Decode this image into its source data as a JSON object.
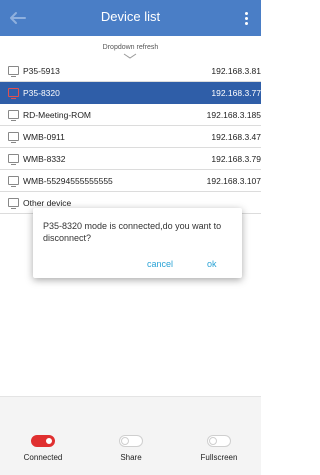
{
  "header": {
    "title": "Device list"
  },
  "refresh_hint": "Dropdown refresh",
  "devices": [
    {
      "name": "P35-5913",
      "ip": "192.168.3.81",
      "selected": false
    },
    {
      "name": "P35-8320",
      "ip": "192.168.3.77",
      "selected": true
    },
    {
      "name": "RD-Meeting-ROM",
      "ip": "192.168.3.185",
      "selected": false
    },
    {
      "name": "WMB-0911",
      "ip": "192.168.3.47",
      "selected": false
    },
    {
      "name": "WMB-8332",
      "ip": "192.168.3.79",
      "selected": false
    },
    {
      "name": "WMB-55294555555555",
      "ip": "192.168.3.107",
      "selected": false
    },
    {
      "name": "Other device",
      "ip": "",
      "selected": false
    }
  ],
  "dialog": {
    "message": "P35-8320 mode is connected,do you want to disconnect?",
    "cancel_label": "cancel",
    "ok_label": "ok"
  },
  "bottom_tabs": [
    {
      "label": "Connected",
      "state": "on"
    },
    {
      "label": "Share",
      "state": "off"
    },
    {
      "label": "Fullscreen",
      "state": "off"
    }
  ],
  "colors": {
    "header": "#4a7ec6",
    "selected_row": "#2f5ea8",
    "toggle_on": "#e03030",
    "dialog_button": "#2aa3d6"
  },
  "icons": [
    "back-arrow-icon",
    "more-vert-icon",
    "chevron-down-icon",
    "device-icon",
    "toggle-switch-icon"
  ]
}
